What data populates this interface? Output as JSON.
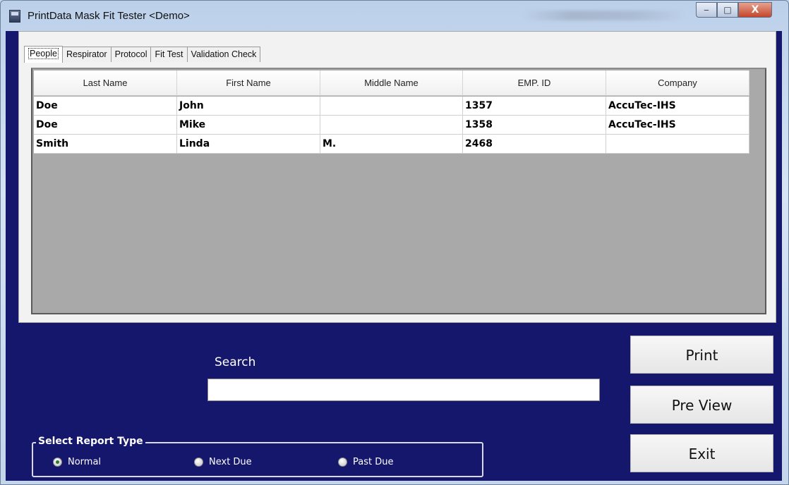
{
  "window": {
    "title": "PrintData Mask Fit Tester <Demo>"
  },
  "window_controls": {
    "minimize": "‒",
    "maximize": "□",
    "close": "X"
  },
  "tabs": [
    {
      "label": "People",
      "active": true
    },
    {
      "label": "Respirator",
      "active": false
    },
    {
      "label": "Protocol",
      "active": false
    },
    {
      "label": "Fit Test",
      "active": false
    },
    {
      "label": "Validation Check",
      "active": false
    }
  ],
  "table": {
    "columns": [
      "Last Name",
      "First Name",
      "Middle Name",
      "EMP. ID",
      "Company"
    ],
    "rows": [
      [
        "Doe",
        "John",
        "",
        "1357",
        "AccuTec-IHS"
      ],
      [
        "Doe",
        "Mike",
        "",
        "1358",
        "AccuTec-IHS"
      ],
      [
        "Smith",
        "Linda",
        "M.",
        "2468",
        ""
      ]
    ]
  },
  "search": {
    "label": "Search",
    "value": ""
  },
  "buttons": {
    "print": "Print",
    "preview": "Pre View",
    "exit": "Exit"
  },
  "report_type": {
    "legend": "Select Report Type",
    "options": [
      {
        "label": "Normal",
        "selected": true
      },
      {
        "label": "Next Due",
        "selected": false
      },
      {
        "label": "Past Due",
        "selected": false
      }
    ]
  },
  "colors": {
    "client_background": "#14176b",
    "radio_selected": "#2d7a35"
  }
}
